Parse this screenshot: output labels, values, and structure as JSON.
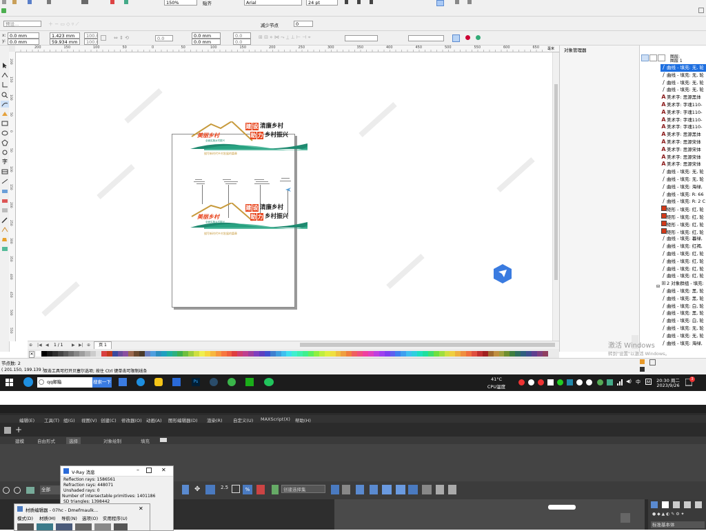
{
  "top_toolbar": {
    "zoom": "150%",
    "snap": "贴齐",
    "font": "Arial",
    "font_size": "24 pt"
  },
  "property_bar": {
    "preset": "预设...",
    "x": "0.0 mm",
    "y": "0.0 mm",
    "width": "1.423 mm",
    "height": "59.934 mm",
    "scale_x": "100.0",
    "scale_y": "100.0",
    "angle": "0.0",
    "pos_x2": "0.0 mm",
    "pos_y2": "0.0 mm",
    "small_x": "0.0",
    "small_y": "0.0",
    "reduce_nodes_label": "减少节点",
    "reduce_nodes_value": "0"
  },
  "ruler": {
    "labels": [
      "200",
      "150",
      "100",
      "50",
      "0",
      "50",
      "100",
      "150",
      "200",
      "250",
      "300",
      "350",
      "400",
      "450",
      "500",
      "550",
      "600",
      "650",
      "700",
      "750",
      "800"
    ],
    "unit": "毫米"
  },
  "vertical_ruler_labels": [
    "200",
    "150",
    "100",
    "50",
    "0",
    "50",
    "100",
    "150",
    "200",
    "250",
    "300",
    "350",
    "400",
    "450",
    "500",
    "550",
    "600"
  ],
  "docker": {
    "title": "对象管理器",
    "tree_root": "图层:",
    "tree_layer": "图层 1",
    "items": [
      {
        "icon": "curve",
        "label": "曲线 - 填充: 无, 轮"
      },
      {
        "icon": "curve",
        "label": "曲线 - 填充: 无, 轮"
      },
      {
        "icon": "curve",
        "label": "曲线 - 填充: 无, 轮"
      },
      {
        "icon": "curve",
        "label": "曲线 - 填充: 无, 轮"
      },
      {
        "icon": "A",
        "label": "美术字: 思源黑体"
      },
      {
        "icon": "A",
        "label": "美术字: 字魂110-"
      },
      {
        "icon": "A",
        "label": "美术字: 字魂110-"
      },
      {
        "icon": "A",
        "label": "美术字: 字魂110-"
      },
      {
        "icon": "A",
        "label": "美术字: 字魂110-"
      },
      {
        "icon": "A",
        "label": "美术字: 思源黑体"
      },
      {
        "icon": "A",
        "label": "美术字: 思源宋体"
      },
      {
        "icon": "A",
        "label": "美术字: 思源宋体"
      },
      {
        "icon": "A",
        "label": "美术字: 思源宋体"
      },
      {
        "icon": "A",
        "label": "美术字: 思源宋体"
      },
      {
        "icon": "curve",
        "label": "曲线 - 填充: 无, 轮"
      },
      {
        "icon": "curve",
        "label": "曲线 - 填充: 无, 轮"
      },
      {
        "icon": "curve",
        "label": "曲线 - 填充: 海绿,"
      },
      {
        "icon": "curve",
        "label": "曲线 - 填充: R: 66"
      },
      {
        "icon": "curve",
        "label": "曲线 - 填充: R: 2 C"
      },
      {
        "icon": "rect",
        "label": "矩形 - 填充: 红, 轮"
      },
      {
        "icon": "rect",
        "label": "矩形 - 填充: 红, 轮"
      },
      {
        "icon": "rect",
        "label": "矩形 - 填充: 红, 轮"
      },
      {
        "icon": "rect",
        "label": "矩形 - 填充: 红, 轮"
      },
      {
        "icon": "curve",
        "label": "曲线 - 填充: 暮绿,"
      },
      {
        "icon": "curve",
        "label": "曲线 - 填充: 红褐,"
      },
      {
        "icon": "curve",
        "label": "曲线 - 填充: 红, 轮"
      },
      {
        "icon": "curve",
        "label": "曲线 - 填充: 红, 轮"
      },
      {
        "icon": "curve",
        "label": "曲线 - 填充: 红, 轮"
      },
      {
        "icon": "curve",
        "label": "曲线 - 填充: 红, 轮"
      },
      {
        "icon": "group",
        "label": "2 对象群组 - 填充:"
      },
      {
        "icon": "curve",
        "label": "曲线 - 填充: 黑, 轮"
      },
      {
        "icon": "curve",
        "label": "曲线 - 填充: 黑, 轮"
      },
      {
        "icon": "curve",
        "label": "曲线 - 填充: 白, 轮"
      },
      {
        "icon": "curve",
        "label": "曲线 - 填充: 黑, 轮"
      },
      {
        "icon": "curve",
        "label": "曲线 - 填充: 白, 轮"
      },
      {
        "icon": "curve",
        "label": "曲线 - 填充: 无, 轮"
      },
      {
        "icon": "curve",
        "label": "曲线 - 填充: 无, 轮"
      },
      {
        "icon": "curve",
        "label": "曲线 - 填充: 海绿,"
      }
    ]
  },
  "artwork": {
    "title_a1": "建",
    "title_a2": "设",
    "title_a3": "清廉乡村",
    "title_b1": "助",
    "title_b2": "力",
    "title_b3": "乡村振兴",
    "logo": "美丽乡村",
    "logo_sub": "全面实施乡村振兴",
    "caption": "描写新时代乡村发展的篇章",
    "red": "#e8461e",
    "green": "#1f8a70",
    "gold": "#c79a3c"
  },
  "page_nav": {
    "counter": "1 / 1",
    "page_tab": "页 1"
  },
  "status": {
    "nodes": "节点数: 2",
    "coords": "( 201.150, 199.139 )",
    "hint": "双击工具可打开贝塞尔选项; 按住 Ctrl 键单击可限制线条"
  },
  "windows_activation": {
    "title": "激活 Windows",
    "subtitle": "转到\"设置\"以激活 Windows。"
  },
  "taskbar": {
    "search_text": "qq邮箱",
    "search_button": "搜索一下",
    "temp": "41°C",
    "temp_label": "CPU温度",
    "ime": "中",
    "time": "20:30 周二",
    "date": "2023/9/26",
    "notif": "3"
  },
  "max": {
    "menu": [
      "编辑(E)",
      "工具(T)",
      "组(G)",
      "视图(V)",
      "创建(C)",
      "修改器(O)",
      "动画(A)",
      "图形编辑器(D)",
      "渲染(R)",
      "自定义(U)",
      "MAXScript(X)",
      "帮助(H)"
    ],
    "tabs": [
      "建模",
      "自由形式",
      "选择",
      "对象绘制",
      "填充"
    ],
    "sel_filter": "全部",
    "named_sel": "创建选择集",
    "vray": {
      "title": "V-Ray 消息",
      "lines": [
        "Reflection rays: 1586561",
        "Refraction rays: 448071",
        "Unshaded rays: 0",
        "Number of intersectable primitives: 1401186",
        "SD triangles: 1398442",
        "MB triangles: 0"
      ]
    },
    "mat_editor": {
      "title": "材质编辑器 - 07hc - Dmefmaulk...",
      "menu": [
        "模式(D)",
        "材质(M)",
        "导航(N)",
        "选项(O)",
        "实用程序(U)"
      ]
    },
    "cmd_panel": "标准基本体"
  },
  "palette": [
    "#ffffff",
    "#000000",
    "#1a1a1a",
    "#2e2e2e",
    "#444444",
    "#5a5a5a",
    "#707070",
    "#878787",
    "#9e9e9e",
    "#b5b5b5",
    "#cccccc",
    "#e3e3e3",
    "#d94040",
    "#c23a1d",
    "#3a4a9e",
    "#6a4c9c",
    "#8a4fa0",
    "#9c6a50",
    "#6a4a30",
    "#4a3a2a",
    "#6a7fbf",
    "#4f9fdf",
    "#2d8fbf",
    "#1f9fbf",
    "#1fb0a0",
    "#2db080",
    "#3fb04f",
    "#6fbf3f",
    "#9fcf3f",
    "#cfdf3f",
    "#efef4f",
    "#f7d73f",
    "#f7b73f",
    "#f7973f",
    "#f7773f",
    "#ef5f3f",
    "#df3f3f",
    "#cf3f6f",
    "#bf3f8f",
    "#9f3f9f",
    "#7f3fbf",
    "#5f3fbf",
    "#3f4fcf",
    "#3f7fcf",
    "#3f9fdf",
    "#3fbfef",
    "#3fdfef",
    "#3fefcf",
    "#3fefaf",
    "#3fef8f",
    "#5fef5f",
    "#8fef3f",
    "#bfef3f",
    "#dfef3f",
    "#efdf3f",
    "#efbf3f",
    "#ef9f3f",
    "#ef7f3f",
    "#ef5f5f",
    "#ef4f7f",
    "#ef3f9f",
    "#df3fbf",
    "#bf3fdf",
    "#9f3fef",
    "#7f3fef",
    "#5f5fef",
    "#3f7fef",
    "#3f9fef",
    "#3fbfef",
    "#2fcfdf",
    "#1fdfbf",
    "#1fdf9f",
    "#3fdf6f",
    "#6fdf3f",
    "#9fdf3f",
    "#cfdf3f",
    "#efcf3f",
    "#efaf3f",
    "#ef8f3f",
    "#ef6f3f",
    "#df4f3f",
    "#c03030",
    "#a02020",
    "#a06a30",
    "#c08f40",
    "#a0a040",
    "#6f8f30",
    "#3f7f3f",
    "#2f6f5f",
    "#2f5f7f",
    "#3f4f8f",
    "#5f3f8f",
    "#7f3f7f",
    "#8f3f5f",
    "#e6b0b0",
    "#e6d0b0",
    "#e6e6b0",
    "#c6e6b0",
    "#b0e6c6",
    "#b0e6e6",
    "#b0c6e6",
    "#c6b0e6",
    "#e6b0d6",
    "#f06b5c",
    "#f07c5c",
    "#f08c5c",
    "#f09c5c",
    "#f0ac5c",
    "#e0504a"
  ]
}
